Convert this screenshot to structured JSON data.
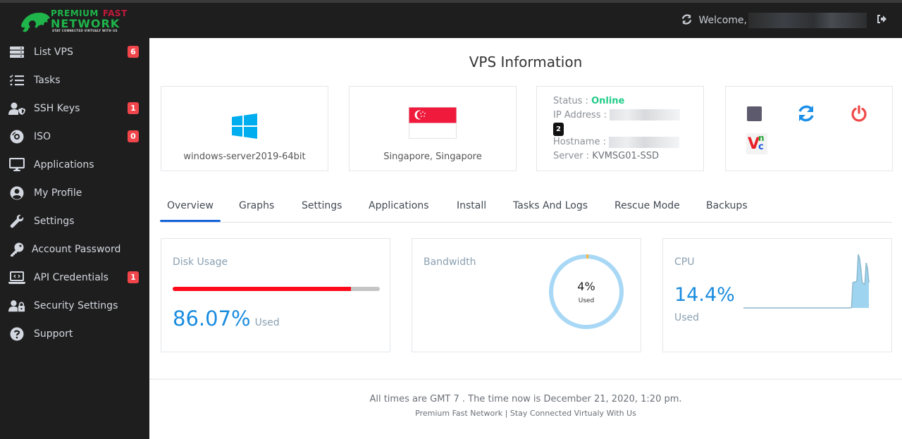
{
  "brand": {
    "line1": "PREMIUM",
    "line1_accent": "FAST",
    "line2": "NETWORK",
    "tagline": "STAY CONNECTED VIRTUALY WITH US"
  },
  "topbar": {
    "welcome_label": "Welcome,",
    "refresh_icon": "refresh-icon",
    "logout_icon": "sign-out-icon"
  },
  "sidebar": {
    "items": [
      {
        "label": "List VPS",
        "icon": "server-icon",
        "badge": "6"
      },
      {
        "label": "Tasks",
        "icon": "tasks-icon",
        "badge": null
      },
      {
        "label": "SSH Keys",
        "icon": "user-shield-icon",
        "badge": "1"
      },
      {
        "label": "ISO",
        "icon": "compact-disc-icon",
        "badge": "0"
      },
      {
        "label": "Applications",
        "icon": "desktop-icon",
        "badge": null
      },
      {
        "label": "My Profile",
        "icon": "user-circle-icon",
        "badge": null
      },
      {
        "label": "Settings",
        "icon": "wrench-icon",
        "badge": null
      },
      {
        "label": "Account Password",
        "icon": "key-icon",
        "badge": null
      },
      {
        "label": "API Credentials",
        "icon": "laptop-code-icon",
        "badge": "1"
      },
      {
        "label": "Security Settings",
        "icon": "user-lock-icon",
        "badge": null
      },
      {
        "label": "Support",
        "icon": "question-circle-icon",
        "badge": null
      }
    ]
  },
  "main": {
    "title": "VPS Information",
    "os": {
      "label": "windows-server2019-64bit",
      "icon": "windows-icon"
    },
    "location": {
      "label": "Singapore, Singapore",
      "icon": "singapore-flag-icon"
    },
    "status": {
      "status_label": "Status :",
      "status_value": "Online",
      "ip_label": "IP Address :",
      "ip_count_badge": "2",
      "hostname_label": "Hostname :",
      "server_label": "Server :",
      "server_value": "KVMSG01-SSD"
    },
    "actions": [
      {
        "name": "stop",
        "icon": "stop-icon"
      },
      {
        "name": "restart",
        "icon": "refresh-icon"
      },
      {
        "name": "power",
        "icon": "power-icon"
      },
      {
        "name": "vnc",
        "icon": "vnc-icon",
        "label_v": "V",
        "label_n": "n",
        "label_c": "c"
      }
    ],
    "tabs": [
      "Overview",
      "Graphs",
      "Settings",
      "Applications",
      "Install",
      "Tasks And Logs",
      "Rescue Mode",
      "Backups"
    ],
    "active_tab": "Overview",
    "disk": {
      "title": "Disk Usage",
      "percent": 86.07,
      "percent_label": "86.07%",
      "used_label": "Used"
    },
    "bandwidth": {
      "title": "Bandwidth",
      "percent": 4,
      "percent_label": "4%",
      "used_label": "Used"
    },
    "cpu": {
      "title": "CPU",
      "percent_label": "14.4%",
      "used_label": "Used",
      "history": [
        0,
        0,
        0,
        0,
        0,
        0,
        0,
        0,
        0,
        0,
        0,
        0,
        0,
        0,
        0,
        0,
        0,
        0,
        0,
        0,
        0,
        0,
        0,
        0,
        0,
        0,
        0,
        0,
        0,
        0,
        0,
        0,
        0,
        0,
        0,
        0,
        0,
        0,
        0,
        0,
        0,
        0,
        0,
        0,
        0,
        0,
        0,
        0,
        0,
        0,
        0,
        0,
        0,
        0,
        0,
        0,
        0,
        0,
        0,
        0,
        0,
        0,
        0,
        0,
        0,
        0,
        0,
        0,
        0,
        0,
        0,
        0,
        0,
        0,
        0,
        0,
        0,
        0,
        0,
        0,
        0,
        1,
        45,
        46,
        46,
        48,
        95,
        88,
        70,
        45,
        43,
        42,
        80,
        70,
        45
      ]
    }
  },
  "footer": {
    "time_line": "All times are GMT 7 . The time now is December 21, 2020, 1:20 pm.",
    "brand_line": "Premium Fast Network | Stay Connected Virtualy With Us"
  },
  "colors": {
    "accent_blue": "#1a8ce0",
    "online_green": "#22cc88",
    "disk_red": "#ff0a1a",
    "badge_red": "#f0454b",
    "bandwidth_ring": "#a8d8f5",
    "bandwidth_used": "#f5b942",
    "tab_active": "#1565d8"
  }
}
